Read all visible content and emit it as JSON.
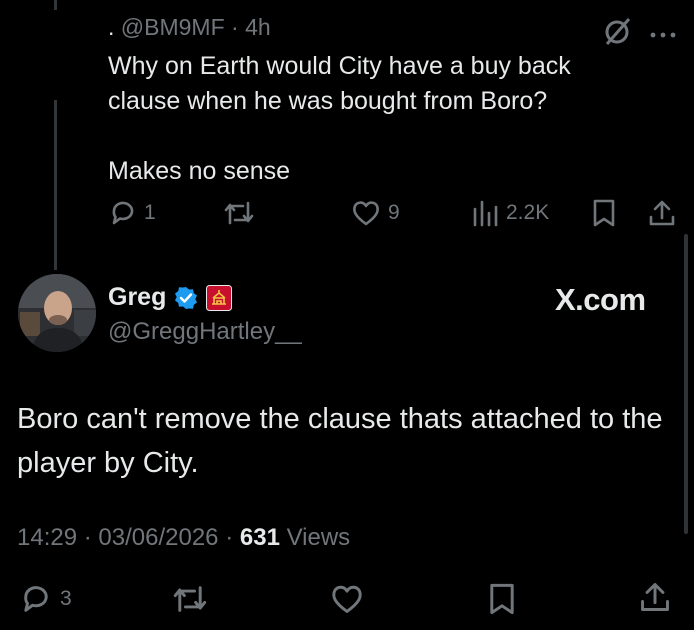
{
  "reply": {
    "prefix": ".",
    "handle": "@BM9MF",
    "sep": "·",
    "time": "4h",
    "line1": "Why on Earth would City have a buy back",
    "line2": "clause when he was bought from Boro?",
    "line3": "Makes no sense",
    "replies": "1",
    "likes": "9",
    "views": "2.2K"
  },
  "main": {
    "name": "Greg",
    "handle": "@GreggHartley__",
    "brand": "X.com",
    "text": "Boro can't remove the clause thats attached to the player by City.",
    "time": "14:29",
    "date": "03/06/2026",
    "sep": "·",
    "views_count": "631",
    "views_label": "Views",
    "replies": "3"
  },
  "colors": {
    "background": "#000000",
    "text": "#e7e9ea",
    "muted": "#71767b",
    "verified": "#1d9bf0",
    "affiliate_badge": "#c8102e"
  },
  "icons": [
    "grok-icon",
    "more-icon",
    "reply-icon",
    "retweet-icon",
    "like-icon",
    "analytics-icon",
    "bookmark-icon",
    "share-icon",
    "verified-badge-icon",
    "affiliate-badge-icon"
  ]
}
